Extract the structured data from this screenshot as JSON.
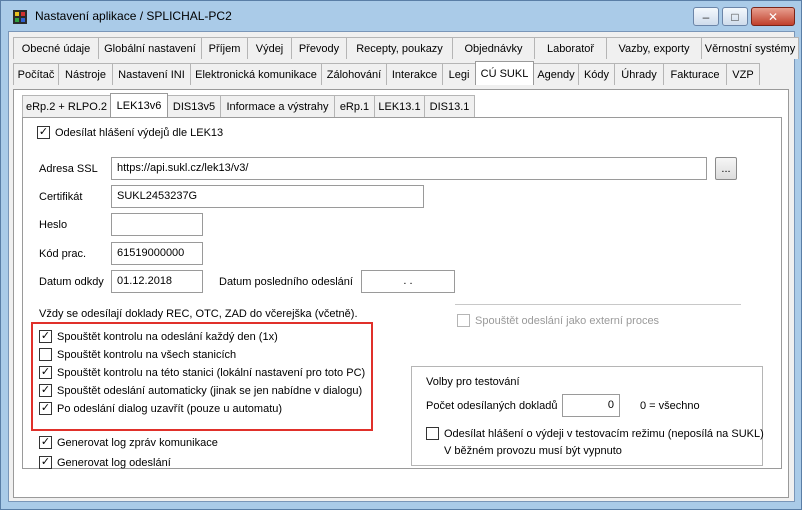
{
  "window": {
    "title": "Nastavení aplikace / SPLICHAL-PC2",
    "minimize": "‒",
    "maximize": "□",
    "close": "✕",
    "close_color": "#c0402c"
  },
  "tabs_row1": [
    "Obecné údaje",
    "Globální nastavení",
    "Příjem",
    "Výdej",
    "Převody",
    "Recepty, poukazy",
    "Objednávky",
    "Laboratoř",
    "Vazby, exporty",
    "Věrnostní systémy"
  ],
  "tabs_row2": [
    "Počítač",
    "Nástroje",
    "Nastavení INI",
    "Elektronická komunikace",
    "Zálohování",
    "Interakce",
    "Legi",
    "CÚ SUKL",
    "Agendy",
    "Kódy",
    "Úhrady",
    "Fakturace",
    "VZP"
  ],
  "tabs_row3": [
    "eRp.2 + RLPO.2",
    "LEK13v6",
    "DIS13v5",
    "Informace a výstrahy",
    "eRp.1",
    "LEK13.1",
    "DIS13.1"
  ],
  "form": {
    "send_reports": {
      "label": "Odesílat hlášení výdejů dle LEK13",
      "checked": true
    },
    "ssl_label": "Adresa SSL",
    "ssl_value": "https://api.sukl.cz/lek13/v3/",
    "browse_label": "...",
    "cert_label": "Certifikát",
    "cert_value": "SUKL2453237G",
    "pass_label": "Heslo",
    "pass_value": "",
    "code_label": "Kód prac.",
    "code_value": "61519000000",
    "date_label": "Datum odkdy",
    "date_value": "01.12.2018",
    "last_label": "Datum posledního odeslání",
    "last_value": " .  .",
    "note": "Vždy se odesílají doklady REC, OTC, ZAD do včerejška (včetně).",
    "external": {
      "label": "Spouštět odeslání jako externí proces",
      "checked": false
    },
    "highlight_color": "#e0302a"
  },
  "highlighted_options": [
    {
      "label": "Spouštět kontrolu na odeslání každý den (1x)",
      "checked": true
    },
    {
      "label": "Spouštět kontrolu na všech stanicích",
      "checked": false
    },
    {
      "label": "Spouštět kontrolu na této stanici (lokální nastavení pro toto PC)",
      "checked": true
    },
    {
      "label": "Spouštět odeslání automaticky (jinak se jen nabídne v dialogu)",
      "checked": true
    },
    {
      "label": "Po odeslání dialog uzavřít (pouze u automatu)",
      "checked": true
    }
  ],
  "log_options": [
    {
      "label": "Generovat log zpráv komunikace",
      "checked": true
    },
    {
      "label": "Generovat log odeslání",
      "checked": true
    }
  ],
  "testing": {
    "title": "Volby pro testování",
    "count_label": "Počet odesílaných dokladů",
    "count_value": "0",
    "count_hint": "0 = všechno",
    "test_mode": {
      "label": "Odesílat hlášení o výdeji v testovacím režimu (neposílá na SUKL)",
      "checked": false
    },
    "test_note": "V běžném provozu musí být vypnuto"
  }
}
